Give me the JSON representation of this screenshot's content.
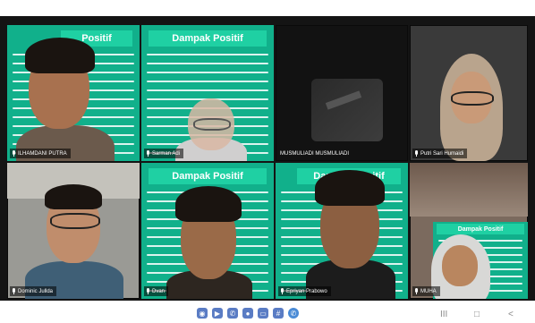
{
  "tiles": [
    {
      "name": "ILHAMDANI PUTRA",
      "slide_title": "Positif"
    },
    {
      "name": "Sarman Adi",
      "slide_title": "Dampak Positif"
    },
    {
      "name": "MUSMULIADI MUSMULIADI"
    },
    {
      "name": "Putri Sari Humaidi"
    },
    {
      "name": "Dominic Jullda"
    },
    {
      "name": "Dvan",
      "slide_title": "Dampak Positif"
    },
    {
      "name": "Epriyan Prabowo",
      "slide_title": "Dampak Positif"
    },
    {
      "name": "MUHA",
      "slide_title": "Dampak Positif"
    }
  ],
  "toolbar": {
    "icons": [
      "camera-icon",
      "video-icon",
      "phone-icon",
      "people-icon",
      "screen-share-icon",
      "grid-icon",
      "whatsapp-icon"
    ]
  },
  "nav": {
    "recents": "III",
    "home": "□",
    "back": "<"
  },
  "colors": {
    "slide": "#11b08b",
    "slide_bar": "#1fd0a3",
    "toolbar_icon": "#5a7cc4"
  }
}
